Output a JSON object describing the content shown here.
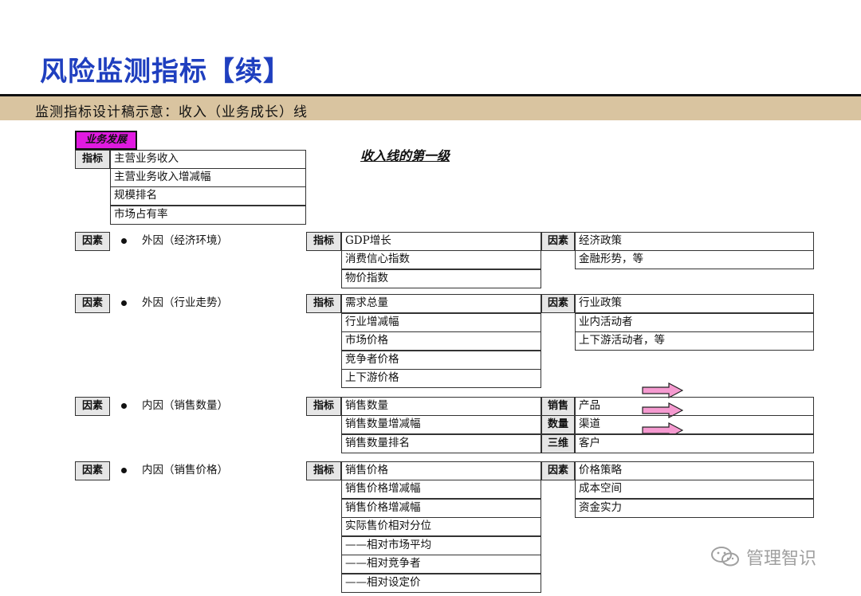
{
  "page_title": "风险监测指标【续】",
  "subtitle": "监测指标设计稿示意：收入（业务成长）线",
  "section_heading": "收入线的第一级",
  "top": {
    "tag": "业务发展",
    "label": "指标",
    "items": [
      "主营业务收入",
      "主营业务收入增减幅",
      "规模排名",
      "市场占有率"
    ]
  },
  "groups": [
    {
      "factor_label": "因素",
      "factor_name": "外因（经济环境）",
      "indicator_label": "指标",
      "indicators": [
        "GDP增长",
        "消费信心指数",
        "物价指数"
      ],
      "right_label": "因素",
      "right_items": [
        "经济政策",
        "金融形势，等"
      ]
    },
    {
      "factor_label": "因素",
      "factor_name": "外因（行业走势）",
      "indicator_label": "指标",
      "indicators": [
        "需求总量",
        "行业增减幅",
        "市场价格",
        "竞争者价格",
        "上下游价格"
      ],
      "right_label": "因素",
      "right_items": [
        "行业政策",
        "业内活动者",
        "上下游活动者，等"
      ]
    },
    {
      "factor_label": "因素",
      "factor_name": "内因（销售数量）",
      "indicator_label": "指标",
      "indicators": [
        "销售数量",
        "销售数量增减幅",
        "销售数量排名"
      ],
      "right_label_lines": [
        "销售",
        "数量",
        "三维"
      ],
      "right_items": [
        "产品",
        "渠道",
        "客户"
      ]
    },
    {
      "factor_label": "因素",
      "factor_name": "内因（销售价格）",
      "indicator_label": "指标",
      "indicators": [
        "销售价格",
        "销售价格增减幅",
        "销售价格增减幅",
        "实际售价相对分位",
        "——相对市场平均",
        "——相对竞争者",
        "——相对设定价"
      ],
      "right_label": "因素",
      "right_items": [
        "价格策略",
        "成本空间",
        "资金实力"
      ]
    }
  ],
  "watermark": "管理智识",
  "colors": {
    "title": "#1f3fbf",
    "band": "#d9c4a0",
    "tag": "#e01ae0",
    "arrow": "#f59ad0"
  }
}
